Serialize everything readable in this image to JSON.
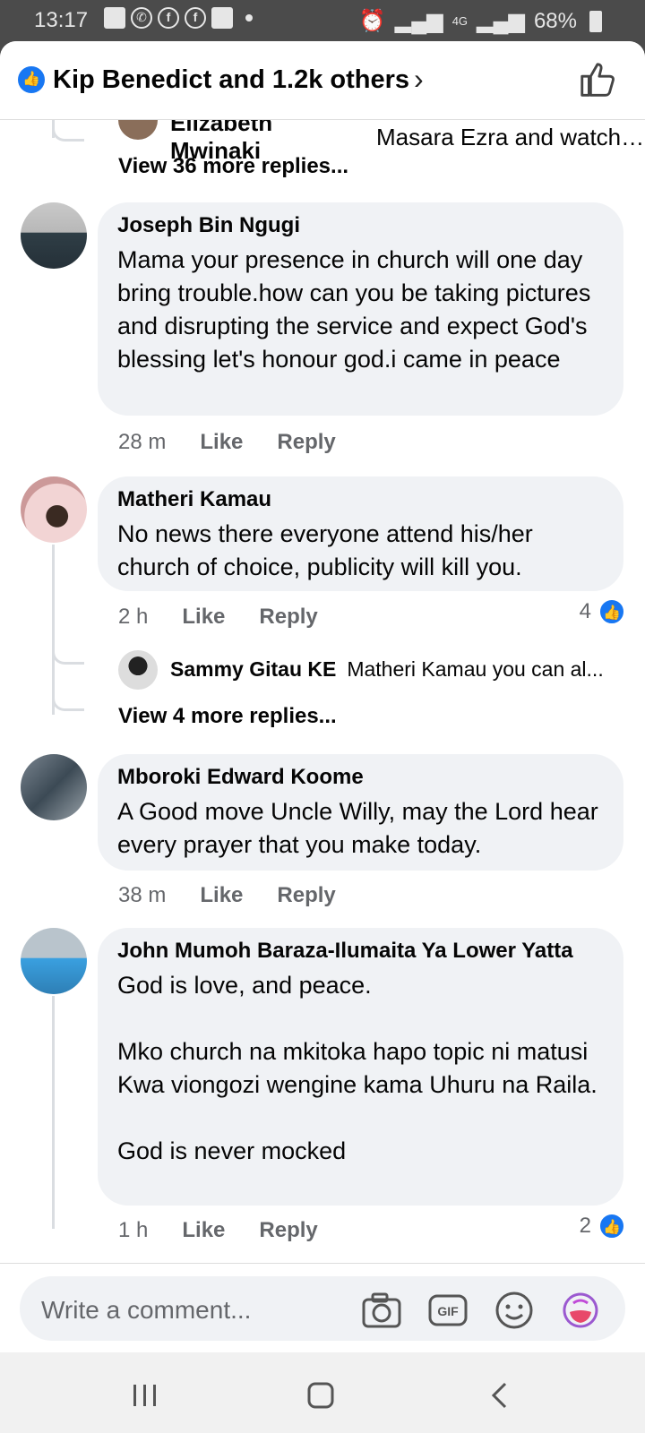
{
  "status_bar": {
    "time": "13:17",
    "network": "4G",
    "battery": "68%"
  },
  "header": {
    "title": "Kip Benedict and 1.2k others",
    "like_icon": "thumbs-up-icon"
  },
  "top_thread": {
    "reply_name": "Elizabeth Mwinaki",
    "reply_text": "Masara Ezra and watche...",
    "more_replies": "View 36 more replies..."
  },
  "comments": [
    {
      "name": "Joseph Bin Ngugi",
      "text": "Mama your presence in church will one day bring trouble.how can you be taking pictures and disrupting the service and expect God's blessing let's honour god.i came in peace",
      "time": "28 m",
      "like": "Like",
      "reply": "Reply"
    },
    {
      "name": "Matheri Kamau",
      "text": "No news there everyone attend his/her church of choice, publicity will kill you.",
      "time": "2 h",
      "like": "Like",
      "reply": "Reply",
      "reactions": "4",
      "sub_reply_name": "Sammy Gitau KE",
      "sub_reply_text": "Matheri Kamau you can al...",
      "more_replies": "View 4 more replies..."
    },
    {
      "name": "Mboroki Edward Koome",
      "text": "A Good move Uncle Willy, may the Lord hear every prayer that you make today.",
      "time": "38 m",
      "like": "Like",
      "reply": "Reply"
    },
    {
      "name": "John Mumoh Baraza-Ilumaita Ya Lower Yatta",
      "text": "God is love, and peace.\n\nMko church na mkitoka hapo topic ni matusi Kwa viongozi wengine kama Uhuru na Raila.\n\nGod is never mocked",
      "time": "1 h",
      "like": "Like",
      "reply": "Reply",
      "reactions": "2"
    }
  ],
  "composer": {
    "placeholder": "Write a comment...",
    "gif_label": "GIF"
  },
  "colors": {
    "accent": "#1877f2",
    "bubble": "#f0f2f5",
    "secondary_text": "#65676b"
  }
}
